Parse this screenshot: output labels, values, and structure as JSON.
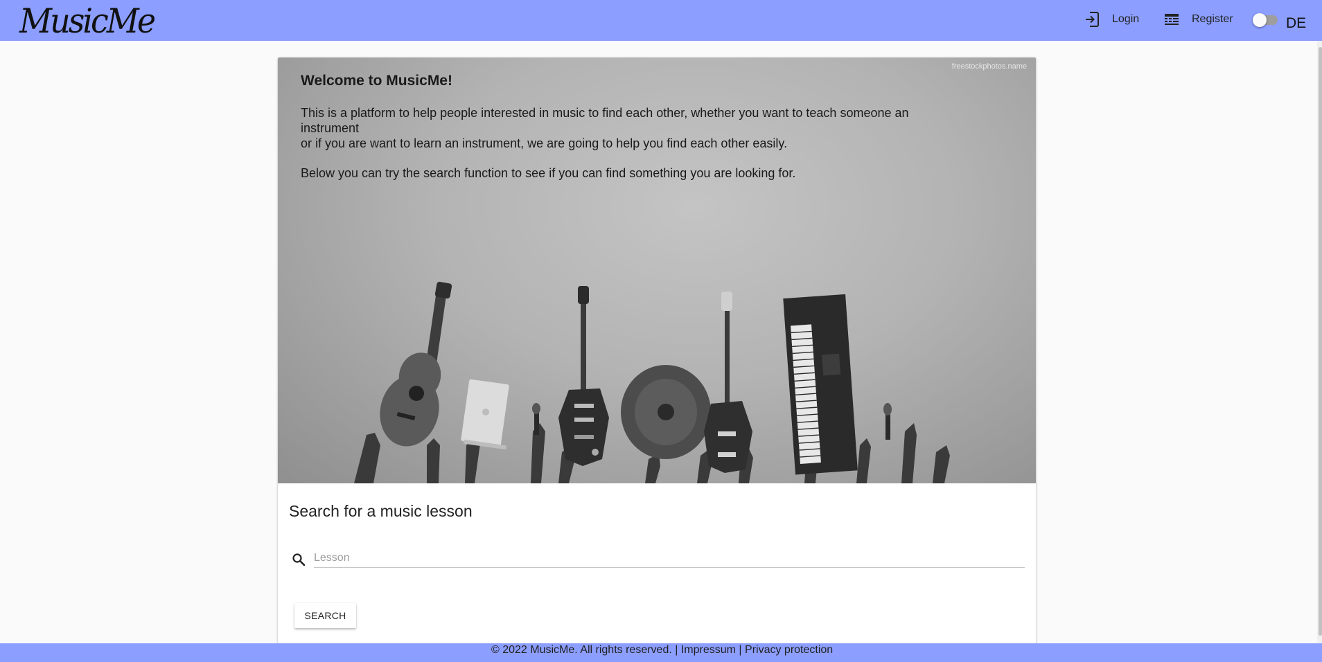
{
  "header": {
    "logo_text": "MusicMe",
    "login_label": "Login",
    "register_label": "Register",
    "language_label": "DE",
    "language_toggle_on": false,
    "accent_color": "#8c9eff"
  },
  "hero": {
    "watermark": "freestockphotos.name",
    "title": "Welcome to MusicMe!",
    "paragraph1_line1": "This is a platform to help people interested in music to find each other, whether you want to teach someone an instrument",
    "paragraph1_line2": "or if you are want to learn an instrument, we are going to help you find each other easily.",
    "paragraph2": "Below you can try the search function to see if you can find something you are looking for."
  },
  "search": {
    "title": "Search for a music lesson",
    "input_value": "",
    "input_placeholder": "Lesson",
    "button_label": "SEARCH",
    "icon": "search-icon"
  },
  "footer": {
    "copyright": "© 2022 MusicMe. All rights reserved.",
    "separator": "|",
    "impressum_link": "Impressum",
    "privacy_link": "Privacy protection"
  }
}
